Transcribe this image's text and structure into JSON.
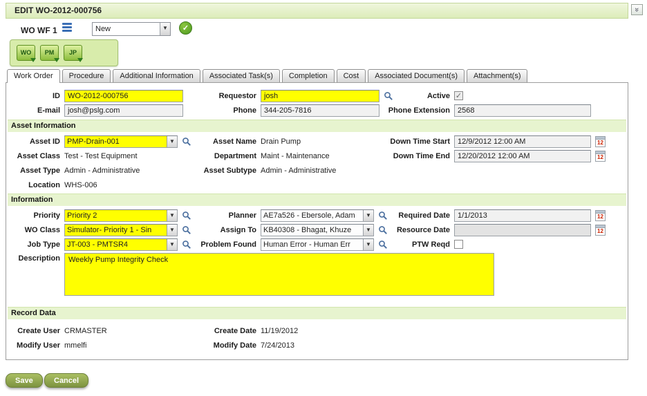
{
  "titlebar": {
    "title": "EDIT WO-2012-000756"
  },
  "workflow": {
    "label": "WO WF 1",
    "status": "New"
  },
  "toolbar": {
    "buttons": [
      {
        "label": "WO"
      },
      {
        "label": "PM"
      },
      {
        "label": "JP"
      }
    ]
  },
  "tabs": [
    {
      "label": "Work Order"
    },
    {
      "label": "Procedure"
    },
    {
      "label": "Additional Information"
    },
    {
      "label": "Associated Task(s)"
    },
    {
      "label": "Completion"
    },
    {
      "label": "Cost"
    },
    {
      "label": "Associated Document(s)"
    },
    {
      "label": "Attachment(s)"
    }
  ],
  "form": {
    "id": {
      "label": "ID",
      "value": "WO-2012-000756"
    },
    "requestor": {
      "label": "Requestor",
      "value": "josh"
    },
    "active": {
      "label": "Active",
      "checked": true
    },
    "email": {
      "label": "E-mail",
      "value": "josh@pslg.com"
    },
    "phone": {
      "label": "Phone",
      "value": "344-205-7816"
    },
    "phone_extension": {
      "label": "Phone Extension",
      "value": "2568"
    }
  },
  "asset": {
    "section_title": "Asset Information",
    "asset_id": {
      "label": "Asset ID",
      "value": "PMP-Drain-001"
    },
    "asset_name": {
      "label": "Asset Name",
      "value": "Drain Pump"
    },
    "down_time_start": {
      "label": "Down Time Start",
      "value": "12/9/2012 12:00 AM"
    },
    "asset_class": {
      "label": "Asset Class",
      "value": "Test - Test Equipment"
    },
    "department": {
      "label": "Department",
      "value": "Maint - Maintenance"
    },
    "down_time_end": {
      "label": "Down Time End",
      "value": "12/20/2012 12:00 AM"
    },
    "asset_type": {
      "label": "Asset Type",
      "value": "Admin - Administrative"
    },
    "asset_subtype": {
      "label": "Asset Subtype",
      "value": "Admin - Administrative"
    },
    "location": {
      "label": "Location",
      "value": "WHS-006"
    }
  },
  "information": {
    "section_title": "Information",
    "priority": {
      "label": "Priority",
      "value": "Priority 2"
    },
    "planner": {
      "label": "Planner",
      "value": "AE7a526 - Ebersole, Adam"
    },
    "required_date": {
      "label": "Required Date",
      "value": "1/1/2013"
    },
    "wo_class": {
      "label": "WO Class",
      "value": "Simulator- Priority 1 - Sin"
    },
    "assign_to": {
      "label": "Assign To",
      "value": "KB40308 - Bhagat, Khuze"
    },
    "resource_date": {
      "label": "Resource Date",
      "value": ""
    },
    "job_type": {
      "label": "Job Type",
      "value": "JT-003 - PMTSR4"
    },
    "problem_found": {
      "label": "Problem Found",
      "value": "Human Error - Human Err"
    },
    "ptw_reqd": {
      "label": "PTW Reqd",
      "checked": false
    },
    "description": {
      "label": "Description",
      "value": "Weekly Pump Integrity Check"
    }
  },
  "record": {
    "section_title": "Record Data",
    "create_user": {
      "label": "Create User",
      "value": "CRMASTER"
    },
    "create_date": {
      "label": "Create Date",
      "value": "11/19/2012"
    },
    "modify_user": {
      "label": "Modify User",
      "value": "mmelfi"
    },
    "modify_date": {
      "label": "Modify Date",
      "value": "7/24/2013"
    }
  },
  "footer": {
    "save_label": "Save",
    "cancel_label": "Cancel"
  },
  "icons": {
    "calendar_text": "12"
  },
  "colors": {
    "required_field": "#ffff00",
    "section_band": "#e7f4cf",
    "button_green": "#8ca554",
    "titlebar_green": "#dcecb9"
  }
}
